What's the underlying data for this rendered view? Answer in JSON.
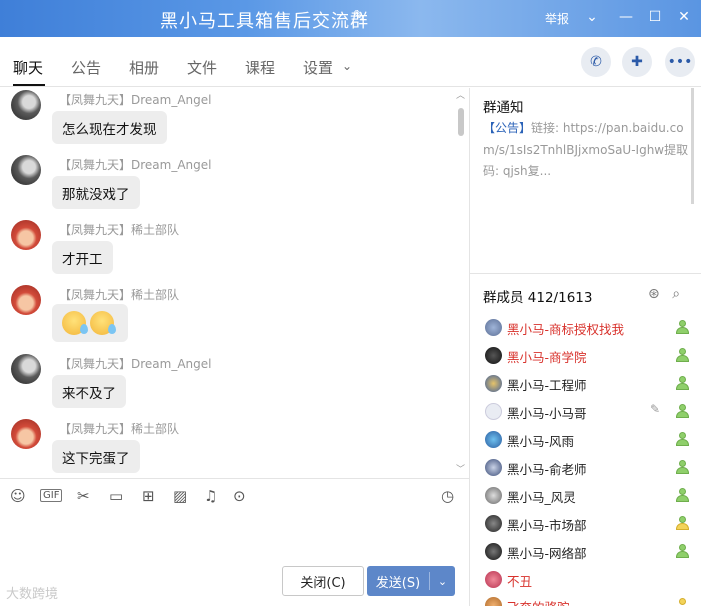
{
  "window": {
    "title": "黑小马工具箱售后交流群",
    "report_label": "举报"
  },
  "tabs": [
    "聊天",
    "公告",
    "相册",
    "文件",
    "课程",
    "设置"
  ],
  "messages": [
    {
      "sender": "【凤舞九天】Dream_Angel",
      "text": "怎么现在才发现",
      "avatar": "dark"
    },
    {
      "sender": "【凤舞九天】Dream_Angel",
      "text": "那就没戏了",
      "avatar": "dark"
    },
    {
      "sender": "【凤舞九天】稀土部队",
      "text": "才开工",
      "avatar": "red"
    },
    {
      "sender": "【凤舞九天】稀土部队",
      "text": "",
      "avatar": "red",
      "emoji_count": 2
    },
    {
      "sender": "【凤舞九天】Dream_Angel",
      "text": "来不及了",
      "avatar": "dark"
    },
    {
      "sender": "【凤舞九天】稀土部队",
      "text": "这下完蛋了",
      "avatar": "red"
    }
  ],
  "input": {
    "close_label": "关闭(C)",
    "send_label": "发送(S)",
    "watermark": "大数跨境"
  },
  "notice": {
    "title": "群通知",
    "tag": "【公告】",
    "body": "链接: https://pan.baidu.com/s/1sIs2TnhlBJjxmoSaU-Ighw提取码: qjsh复..."
  },
  "members": {
    "title": "群成员 412/1613",
    "list": [
      {
        "name": "黑小马-商标授权找我",
        "highlight": true
      },
      {
        "name": "黑小马-商学院",
        "highlight": true
      },
      {
        "name": "黑小马-工程师",
        "highlight": false
      },
      {
        "name": "黑小马-小马哥",
        "highlight": false
      },
      {
        "name": "黑小马-风雨",
        "highlight": false
      },
      {
        "name": "黑小马-俞老师",
        "highlight": false
      },
      {
        "name": "黑小马_风灵",
        "highlight": false
      },
      {
        "name": "黑小马-市场部",
        "highlight": false
      },
      {
        "name": "黑小马-网络部",
        "highlight": false
      },
      {
        "name": "不丑",
        "highlight": true
      },
      {
        "name": "飞奔的骆驼",
        "highlight": true
      }
    ]
  }
}
